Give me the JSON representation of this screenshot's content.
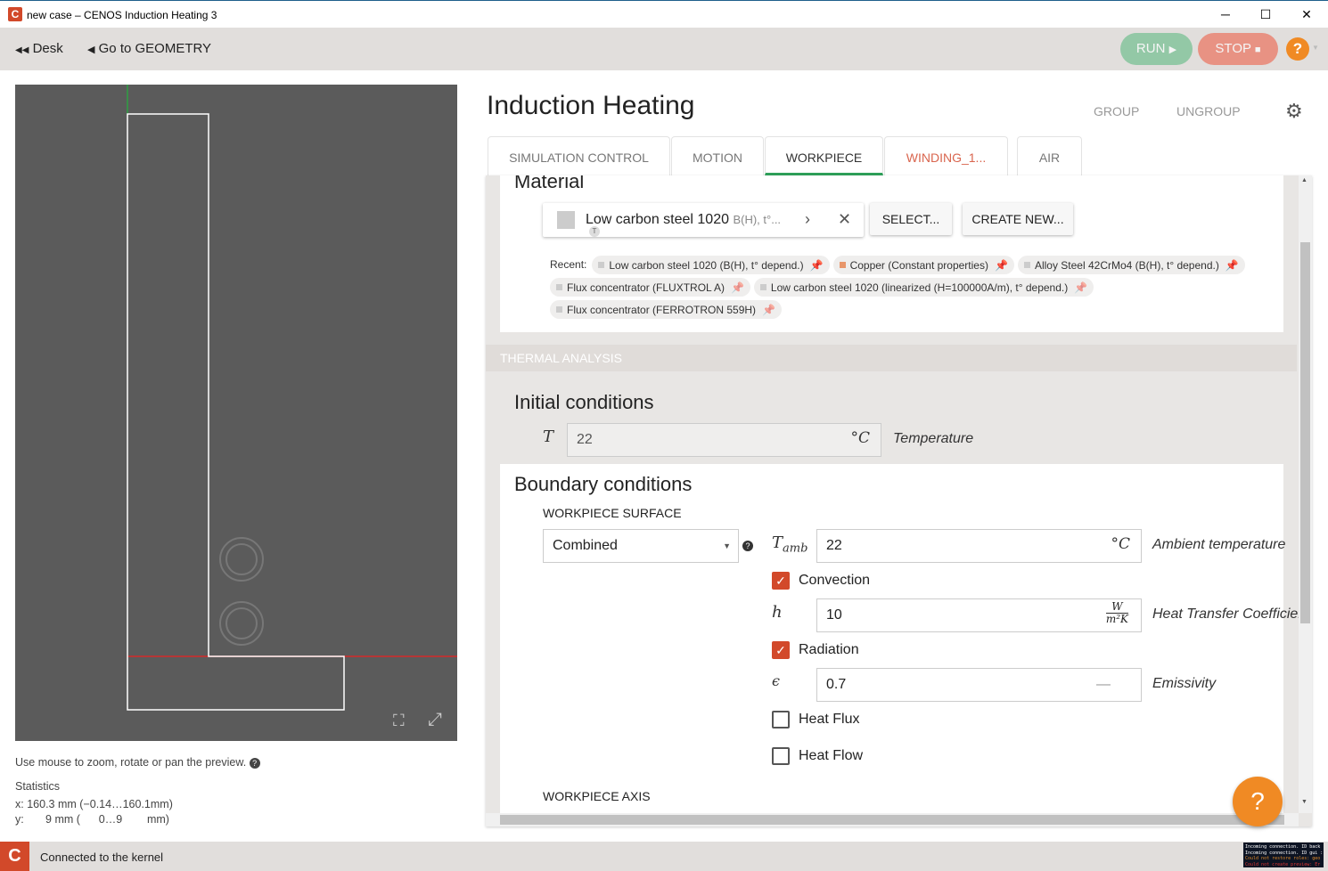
{
  "window": {
    "title": "new case – CENOS Induction Heating 3",
    "minimize": "─",
    "maximize": "☐",
    "close": "✕"
  },
  "toolbar": {
    "desk": "Desk",
    "geometry": "Go to GEOMETRY",
    "run": "RUN",
    "stop": "STOP",
    "help": "?",
    "run_color": "#93c8a6",
    "stop_color": "#e89283"
  },
  "preview": {
    "hint": "Use mouse to zoom, rotate or pan the preview.",
    "stats_title": "Statistics",
    "x_label": "x:",
    "x_size": "160.3 mm",
    "x_range": "(−0.14…160.1mm)",
    "y_label": "y:",
    "y_size": "9 mm",
    "y_range": "(      0…9        mm)"
  },
  "main": {
    "title": "Induction Heating",
    "group": "GROUP",
    "ungroup": "UNGROUP",
    "tabs": [
      {
        "label": "SIMULATION CONTROL"
      },
      {
        "label": "MOTION"
      },
      {
        "label": "WORKPIECE",
        "active": true
      },
      {
        "label": "WINDING_1..."
      },
      {
        "label": "AIR"
      }
    ],
    "material": {
      "heading": "Material",
      "selected": "Low carbon steel 1020",
      "selected_detail": "B(H), t°...",
      "badge": "T",
      "select": "SELECT...",
      "create": "CREATE NEW...",
      "recent_label": "Recent:",
      "recent": [
        {
          "name": "Low carbon steel 1020 (B(H), t° depend.)",
          "color": "#cccccc",
          "pinned": true
        },
        {
          "name": "Copper (Constant properties)",
          "color": "#e8966a",
          "pinned": true
        },
        {
          "name": "Alloy Steel 42CrMo4 (B(H), t° depend.)",
          "color": "#cccccc",
          "pinned": true
        },
        {
          "name": "Flux concentrator (FLUXTROL A)",
          "color": "#cccccc",
          "pinned": false
        },
        {
          "name": "Low carbon steel 1020 (linearized (H=100000A/m), t° depend.)",
          "color": "#cccccc",
          "pinned": false
        },
        {
          "name": "Flux concentrator (FERROTRON 559H)",
          "color": "#cccccc",
          "pinned": false
        }
      ]
    },
    "thermal_header": "THERMAL ANALYSIS",
    "initial": {
      "heading": "Initial conditions",
      "symbol": "T",
      "value": "22",
      "unit": "°C",
      "desc": "Temperature"
    },
    "boundary": {
      "heading": "Boundary conditions",
      "surface_label": "WORKPIECE SURFACE",
      "type": "Combined",
      "tamb": {
        "symbol": "T",
        "sub": "amb",
        "value": "22",
        "unit": "°C",
        "desc": "Ambient temperature"
      },
      "convection": {
        "label": "Convection",
        "checked": true
      },
      "h": {
        "symbol": "h",
        "value": "10",
        "unit_num": "W",
        "unit_den": "m²K",
        "desc": "Heat Transfer Coefficient"
      },
      "radiation": {
        "label": "Radiation",
        "checked": true
      },
      "eps": {
        "symbol": "ϵ",
        "value": "0.7",
        "unit": "—",
        "desc": "Emissivity"
      },
      "heat_flux": {
        "label": "Heat Flux",
        "checked": false
      },
      "heat_flow": {
        "label": "Heat Flow",
        "checked": false
      },
      "axis_label": "WORKPIECE AXIS"
    }
  },
  "status": {
    "text": "Connected to the kernel",
    "console": [
      "Incoming connection. ID back",
      "Incoming connection. ID gui :",
      "Could not restore roles: geo",
      "Could not create preview: Er"
    ]
  }
}
